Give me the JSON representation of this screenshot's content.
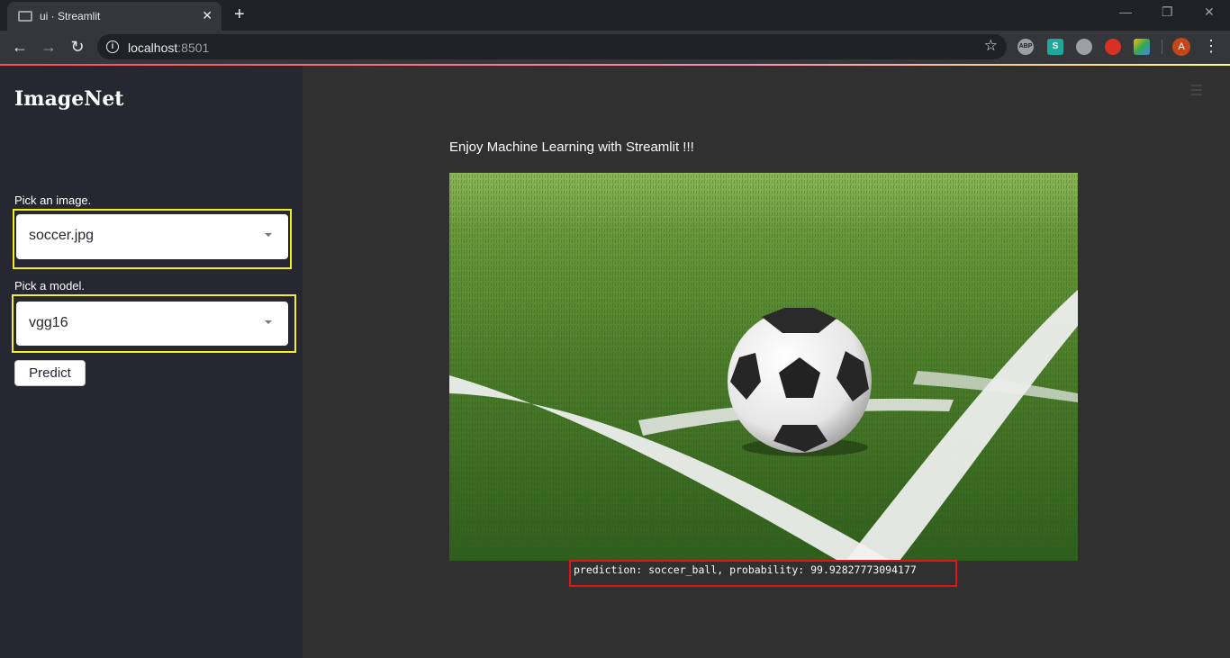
{
  "browser": {
    "tab_title": "ui · Streamlit",
    "url_host": "localhost",
    "url_port": ":8501",
    "new_tab_label": "+",
    "tab_close_label": "✕",
    "avatar_letter": "A",
    "extensions": [
      "ABP",
      "S",
      "globe",
      "santa",
      "layers"
    ],
    "extension_badge": "1"
  },
  "sidebar": {
    "title": "ImageNet",
    "image_label": "Pick an image.",
    "image_value": "soccer.jpg",
    "model_label": "Pick a model.",
    "model_value": "vgg16",
    "predict_button": "Predict"
  },
  "main": {
    "heading": "Enjoy Machine Learning with Streamlit !!!",
    "result": "prediction: soccer_ball, probability: 99.92827773094177"
  },
  "colors": {
    "sidebar_bg": "#262730",
    "main_bg": "#303030",
    "highlight_yellow": "#f0f020",
    "highlight_red": "#e01414"
  }
}
